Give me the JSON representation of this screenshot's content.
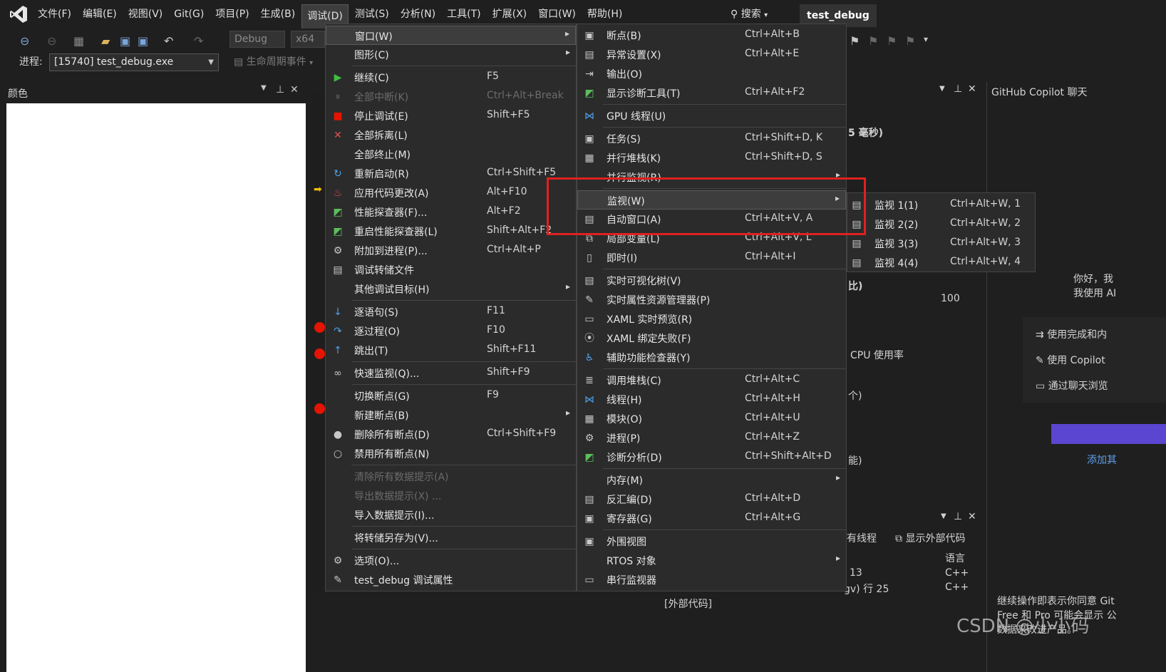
{
  "menubar": {
    "items": [
      "文件(F)",
      "编辑(E)",
      "视图(V)",
      "Git(G)",
      "项目(P)",
      "生成(B)",
      "调试(D)",
      "测试(S)",
      "分析(N)",
      "工具(T)",
      "扩展(X)",
      "窗口(W)",
      "帮助(H)"
    ],
    "search": "搜索",
    "solution": "test_debug"
  },
  "toolbar": {
    "config": "Debug",
    "platform": "x64",
    "process_label": "进程:",
    "process_value": "[15740] test_debug.exe",
    "lifecycle": "生命周期事件"
  },
  "color_panel": {
    "title": "颜色"
  },
  "copilot": {
    "title": "GitHub Copilot 聊天",
    "greeting1": "你好，我",
    "greeting2": "我使用 AI",
    "opt1": "使用完成和内",
    "opt2": "使用 Copilot",
    "opt3": "通过聊天浏览",
    "add": "添加其",
    "footer1": "继续操作即表示你同意 Git",
    "footer2": "Free 和 Pro 可能会显示 公",
    "footer3": "数据来改进产品。"
  },
  "diag": {
    "ms": "5 毫秒)",
    "pct": "比)",
    "val100": "100",
    "cpu": "CPU 使用率",
    "ge": "个)",
    "neng": "能)",
    "threads": "有线程",
    "ext_code": "显示外部代码",
    "lang": "语言",
    "row1": "13",
    "row1_lang": "C++",
    "row2": "gv) 行 25",
    "row2_lang": "C++",
    "external": "[外部代码]"
  },
  "debug_menu": [
    {
      "icon": "",
      "label": "窗口(W)",
      "key": "",
      "arrow": true,
      "hl": true
    },
    {
      "icon": "",
      "label": "图形(C)",
      "key": "",
      "arrow": true
    },
    {
      "sep": true
    },
    {
      "icon": "continue-icon",
      "label": "继续(C)",
      "key": "F5"
    },
    {
      "icon": "pause-icon",
      "label": "全部中断(K)",
      "key": "Ctrl+Alt+Break",
      "disabled": true
    },
    {
      "icon": "stop-icon",
      "label": "停止调试(E)",
      "key": "Shift+F5"
    },
    {
      "icon": "detach-icon",
      "label": "全部拆离(L)",
      "key": ""
    },
    {
      "icon": "",
      "label": "全部终止(M)",
      "key": ""
    },
    {
      "icon": "restart-icon",
      "label": "重新启动(R)",
      "key": "Ctrl+Shift+F5"
    },
    {
      "icon": "hot-reload-icon",
      "label": "应用代码更改(A)",
      "key": "Alt+F10"
    },
    {
      "icon": "profiler-icon",
      "label": "性能探查器(F)...",
      "key": "Alt+F2"
    },
    {
      "icon": "profiler-icon",
      "label": "重启性能探查器(L)",
      "key": "Shift+Alt+F2"
    },
    {
      "icon": "attach-icon",
      "label": "附加到进程(P)...",
      "key": "Ctrl+Alt+P"
    },
    {
      "icon": "dump-icon",
      "label": "调试转储文件",
      "key": ""
    },
    {
      "icon": "",
      "label": "其他调试目标(H)",
      "key": "",
      "arrow": true
    },
    {
      "sep": true
    },
    {
      "icon": "step-into-icon",
      "label": "逐语句(S)",
      "key": "F11"
    },
    {
      "icon": "step-over-icon",
      "label": "逐过程(O)",
      "key": "F10"
    },
    {
      "icon": "step-out-icon",
      "label": "跳出(T)",
      "key": "Shift+F11"
    },
    {
      "sep": true
    },
    {
      "icon": "quickwatch-icon",
      "label": "快速监视(Q)...",
      "key": "Shift+F9"
    },
    {
      "sep": true
    },
    {
      "icon": "",
      "label": "切换断点(G)",
      "key": "F9"
    },
    {
      "icon": "",
      "label": "新建断点(B)",
      "key": "",
      "arrow": true
    },
    {
      "icon": "delete-bp-icon",
      "label": "删除所有断点(D)",
      "key": "Ctrl+Shift+F9"
    },
    {
      "icon": "disable-bp-icon",
      "label": "禁用所有断点(N)",
      "key": ""
    },
    {
      "sep": true
    },
    {
      "icon": "",
      "label": "清除所有数据提示(A)",
      "key": "",
      "disabled": true
    },
    {
      "icon": "",
      "label": "导出数据提示(X) ...",
      "key": "",
      "disabled": true
    },
    {
      "icon": "",
      "label": "导入数据提示(I)...",
      "key": ""
    },
    {
      "sep": true
    },
    {
      "icon": "",
      "label": "将转储另存为(V)...",
      "key": ""
    },
    {
      "sep": true
    },
    {
      "icon": "gear-icon",
      "label": "选项(O)...",
      "key": ""
    },
    {
      "icon": "wrench-icon",
      "label": "test_debug 调试属性",
      "key": ""
    }
  ],
  "window_menu": [
    {
      "icon": "breakpoint-window-icon",
      "label": "断点(B)",
      "key": "Ctrl+Alt+B"
    },
    {
      "icon": "exception-icon",
      "label": "异常设置(X)",
      "key": "Ctrl+Alt+E"
    },
    {
      "icon": "output-icon",
      "label": "输出(O)",
      "key": ""
    },
    {
      "icon": "diag-icon",
      "label": "显示诊断工具(T)",
      "key": "Ctrl+Alt+F2"
    },
    {
      "sep": true
    },
    {
      "icon": "gpu-icon",
      "label": "GPU 线程(U)",
      "key": ""
    },
    {
      "sep": true
    },
    {
      "icon": "task-icon",
      "label": "任务(S)",
      "key": "Ctrl+Shift+D, K"
    },
    {
      "icon": "parallel-stack-icon",
      "label": "并行堆栈(K)",
      "key": "Ctrl+Shift+D, S"
    },
    {
      "icon": "",
      "label": "并行监视(R)",
      "key": "",
      "arrow": true
    },
    {
      "sep": true
    },
    {
      "icon": "",
      "label": "监视(W)",
      "key": "",
      "arrow": true,
      "hl": true
    },
    {
      "icon": "autos-icon",
      "label": "自动窗口(A)",
      "key": "Ctrl+Alt+V, A"
    },
    {
      "icon": "locals-icon",
      "label": "局部变量(L)",
      "key": "Ctrl+Alt+V, L"
    },
    {
      "icon": "immediate-icon",
      "label": "即时(I)",
      "key": "Ctrl+Alt+I"
    },
    {
      "sep": true
    },
    {
      "icon": "visual-tree-icon",
      "label": "实时可视化树(V)",
      "key": ""
    },
    {
      "icon": "wrench-icon",
      "label": "实时属性资源管理器(P)",
      "key": ""
    },
    {
      "icon": "xaml-preview-icon",
      "label": "XAML 实时预览(R)",
      "key": ""
    },
    {
      "icon": "xaml-bind-icon",
      "label": "XAML 绑定失败(F)",
      "key": ""
    },
    {
      "icon": "accessibility-icon",
      "label": "辅助功能检查器(Y)",
      "key": ""
    },
    {
      "sep": true
    },
    {
      "icon": "callstack-icon",
      "label": "调用堆栈(C)",
      "key": "Ctrl+Alt+C"
    },
    {
      "icon": "thread-icon",
      "label": "线程(H)",
      "key": "Ctrl+Alt+H"
    },
    {
      "icon": "module-icon",
      "label": "模块(O)",
      "key": "Ctrl+Alt+U"
    },
    {
      "icon": "process-icon",
      "label": "进程(P)",
      "key": "Ctrl+Alt+Z"
    },
    {
      "icon": "diag-icon",
      "label": "诊断分析(D)",
      "key": "Ctrl+Shift+Alt+D"
    },
    {
      "sep": true
    },
    {
      "icon": "",
      "label": "内存(M)",
      "key": "",
      "arrow": true
    },
    {
      "icon": "disasm-icon",
      "label": "反汇编(D)",
      "key": "Ctrl+Alt+D"
    },
    {
      "icon": "register-icon",
      "label": "寄存器(G)",
      "key": "Ctrl+Alt+G"
    },
    {
      "sep": true
    },
    {
      "icon": "peripheral-icon",
      "label": "外围视图",
      "key": ""
    },
    {
      "icon": "",
      "label": "RTOS 对象",
      "key": "",
      "arrow": true
    },
    {
      "icon": "serial-icon",
      "label": "串行监视器",
      "key": ""
    }
  ],
  "watch_menu": [
    {
      "icon": "watch-icon",
      "label": "监视 1(1)",
      "key": "Ctrl+Alt+W, 1"
    },
    {
      "icon": "watch-icon",
      "label": "监视 2(2)",
      "key": "Ctrl+Alt+W, 2"
    },
    {
      "icon": "watch-icon",
      "label": "监视 3(3)",
      "key": "Ctrl+Alt+W, 3"
    },
    {
      "icon": "watch-icon",
      "label": "监视 4(4)",
      "key": "Ctrl+Alt+W, 4"
    }
  ],
  "watermark": "CSDN @小小码"
}
